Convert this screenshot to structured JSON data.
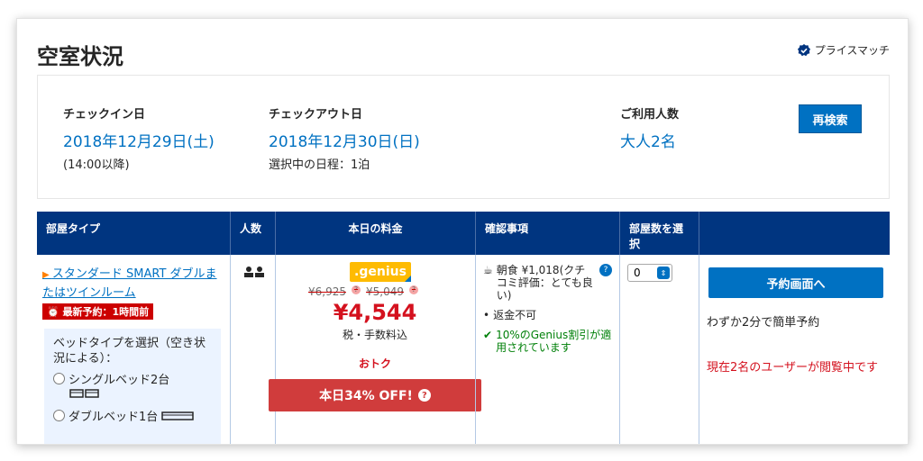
{
  "header": {
    "title": "空室状況",
    "price_match": "プライスマッチ"
  },
  "search": {
    "checkin_label": "チェックイン日",
    "checkin_date": "2018年12月29日(土)",
    "checkin_time": "(14:00以降)",
    "checkout_label": "チェックアウト日",
    "checkout_date": "2018年12月30日(日)",
    "nights": "選択中の日程：1泊",
    "guests_label": "ご利用人数",
    "guests_value": "大人2名",
    "research_button": "再検索"
  },
  "table": {
    "headers": [
      "部屋タイプ",
      "人数",
      "本日の料金",
      "確認事項",
      "部屋数を選択",
      ""
    ],
    "room": {
      "name": "スタンダード SMART ダブルまたはツインルーム",
      "recent_badge": "最新予約：1時間前",
      "bed_prompt": "ベッドタイプを選択（空き状況による）：",
      "bed_options": [
        "シングルベッド2台",
        "ダブルベッド1台"
      ]
    },
    "price": {
      "genius_label": ".genius",
      "old_price_1": "¥6,925",
      "old_price_2": "¥5,049",
      "new_price": "¥4,544",
      "tax_note": "税・手数料込",
      "deal_label": "おトク",
      "off_banner": "本日34% OFF!"
    },
    "conditions": {
      "breakfast": "朝食 ¥1,018(クチコミ評価：とても良い)",
      "refund": "返金不可",
      "genius_discount": "10%のGenius割引が適用されています"
    },
    "rooms_select": {
      "value": "0"
    },
    "actions": {
      "reserve_button": "予約画面へ",
      "quick_note": "わずか2分で簡単予約",
      "viewing_note": "現在2名のユーザーが閲覧中です"
    }
  },
  "colors": {
    "header_bg": "#003580",
    "link_blue": "#0071c2",
    "price_red": "#d4111e",
    "genius_yellow": "#febb02",
    "banner_red": "#d03c3c",
    "genius_green": "#008009"
  }
}
